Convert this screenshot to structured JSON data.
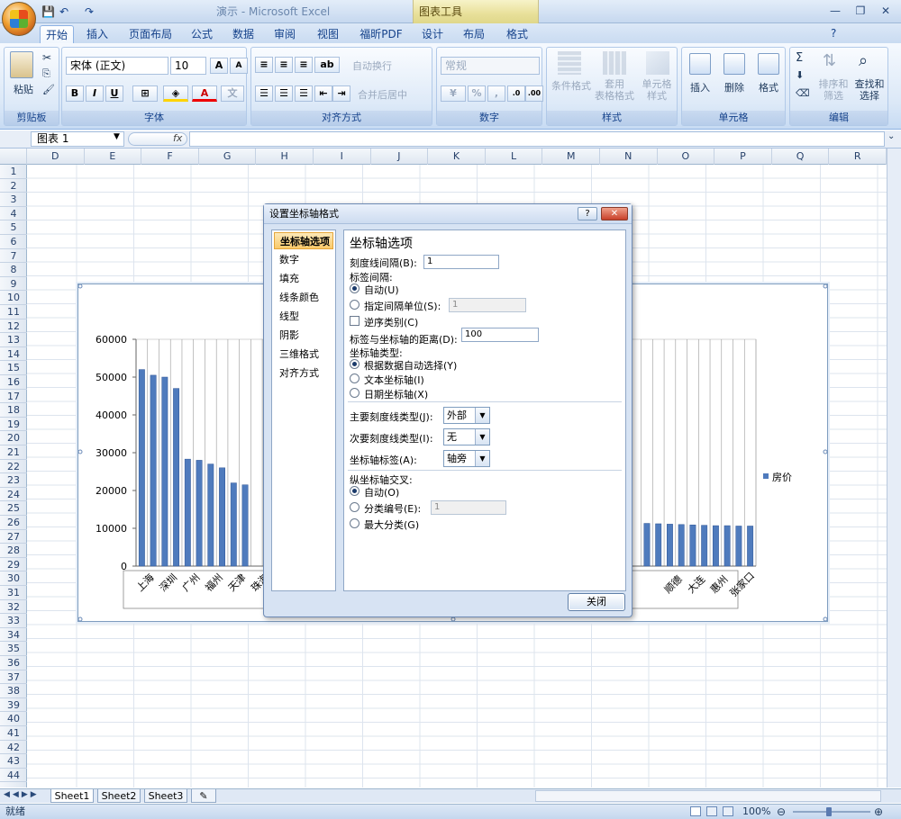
{
  "app": {
    "title": "演示 - Microsoft Excel",
    "chart_tools": "图表工具"
  },
  "qat": {
    "save": "💾",
    "undo": "↶",
    "redo": "↷"
  },
  "tabs": [
    "开始",
    "插入",
    "页面布局",
    "公式",
    "数据",
    "审阅",
    "视图",
    "福昕PDF",
    "设计",
    "布局",
    "格式"
  ],
  "ribbon": {
    "clipboard": {
      "label": "剪贴板",
      "paste": "粘贴"
    },
    "font": {
      "label": "字体",
      "name": "宋体 (正文)",
      "size": "10",
      "bold": "B",
      "italic": "I",
      "underline": "U",
      "grow": "A",
      "shrink": "A"
    },
    "alignment": {
      "label": "对齐方式",
      "wrap": "自动换行",
      "merge": "合并后居中"
    },
    "number": {
      "label": "数字",
      "format": "常规",
      "percent": "%"
    },
    "styles": {
      "label": "样式",
      "cond": "条件格式",
      "table": "套用\n表格格式",
      "cell": "单元格\n样式"
    },
    "cells": {
      "label": "单元格",
      "insert": "插入",
      "delete": "删除",
      "format": "格式"
    },
    "editing": {
      "label": "编辑",
      "sort": "排序和\n筛选",
      "find": "查找和\n选择"
    }
  },
  "formula_bar": {
    "name_box": "图表 1",
    "fx": "fx"
  },
  "columns": [
    "D",
    "E",
    "F",
    "G",
    "H",
    "I",
    "J",
    "K",
    "L",
    "M",
    "N",
    "O",
    "P",
    "Q",
    "R"
  ],
  "rows": [
    "1",
    "2",
    "3",
    "4",
    "5",
    "6",
    "7",
    "8",
    "9",
    "10",
    "11",
    "12",
    "13",
    "14",
    "15",
    "16",
    "17",
    "18",
    "19",
    "20",
    "21",
    "22",
    "23",
    "24",
    "25",
    "26",
    "27",
    "28",
    "29",
    "30",
    "31",
    "32",
    "33",
    "34",
    "35",
    "36",
    "37",
    "38",
    "39",
    "40",
    "41",
    "42",
    "43",
    "44"
  ],
  "chart_data": {
    "type": "bar",
    "ylim": [
      0,
      60000
    ],
    "yticks": [
      "0",
      "10000",
      "20000",
      "30000",
      "40000",
      "50000",
      "60000"
    ],
    "legend": "房价",
    "legend_position": "right",
    "grid": true,
    "visible_left_labels": [
      "上海",
      "深圳",
      "广州",
      "福州",
      "天津",
      "珠海"
    ],
    "visible_right_labels": [
      "顺德",
      "大连",
      "惠州",
      "张家口"
    ],
    "left_values": [
      52000,
      50500,
      50000,
      47000,
      28300,
      28000,
      27000,
      26000,
      22000,
      21500
    ],
    "right_values": [
      11300,
      11200,
      11100,
      11000,
      10900,
      10800,
      10700,
      10700,
      10600,
      10600
    ]
  },
  "dialog": {
    "title": "设置坐标轴格式",
    "help": "?",
    "close_x": "✕",
    "nav": [
      "坐标轴选项",
      "数字",
      "填充",
      "线条颜色",
      "线型",
      "阴影",
      "三维格式",
      "对齐方式"
    ],
    "heading": "坐标轴选项",
    "tick_interval_label": "刻度线间隔(B):",
    "tick_interval_value": "1",
    "label_interval_label": "标签间隔:",
    "auto_label": "自动(U)",
    "specify_label": "指定间隔单位(S):",
    "specify_value": "1",
    "reverse_label": "逆序类别(C)",
    "distance_label": "标签与坐标轴的距离(D):",
    "distance_value": "100",
    "axis_type_label": "坐标轴类型:",
    "axis_auto": "根据数据自动选择(Y)",
    "axis_text": "文本坐标轴(I)",
    "axis_date": "日期坐标轴(X)",
    "major_tick_label": "主要刻度线类型(J):",
    "major_tick_value": "外部",
    "minor_tick_label": "次要刻度线类型(I):",
    "minor_tick_value": "无",
    "axis_labels_label": "坐标轴标签(A):",
    "axis_labels_value": "轴旁",
    "cross_label": "纵坐标轴交叉:",
    "cross_auto": "自动(O)",
    "cross_cat": "分类编号(E):",
    "cross_cat_value": "1",
    "cross_max": "最大分类(G)",
    "close_button": "关闭"
  },
  "sheets": [
    "Sheet1",
    "Sheet2",
    "Sheet3"
  ],
  "status": {
    "ready": "就绪",
    "zoom": "100%"
  }
}
